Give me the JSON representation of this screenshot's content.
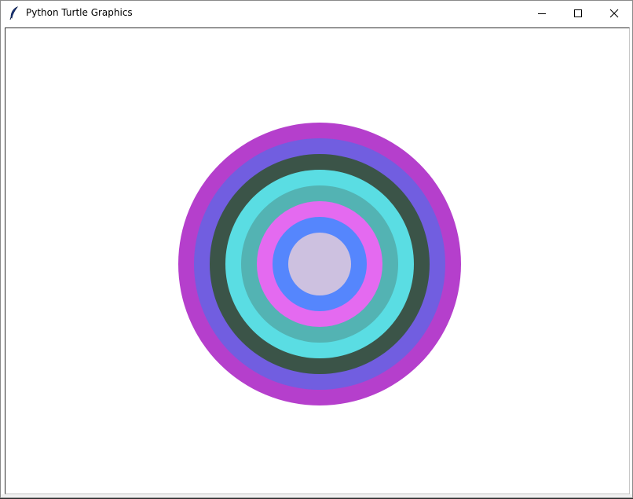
{
  "window": {
    "title": "Python Turtle Graphics",
    "icon": "feather-icon",
    "controls": {
      "minimize_icon": "minimize-icon",
      "maximize_icon": "maximize-icon",
      "close_icon": "close-icon"
    }
  },
  "canvas": {
    "background": "#ffffff",
    "rings": [
      {
        "color": "#b53fcc"
      },
      {
        "color": "#715ee0"
      },
      {
        "color": "#3b5448"
      },
      {
        "color": "#5addE3"
      },
      {
        "color": "#53b3b3"
      },
      {
        "color": "#e46af0"
      },
      {
        "color": "#5586fd"
      },
      {
        "color": "#cdc1e0"
      }
    ]
  }
}
